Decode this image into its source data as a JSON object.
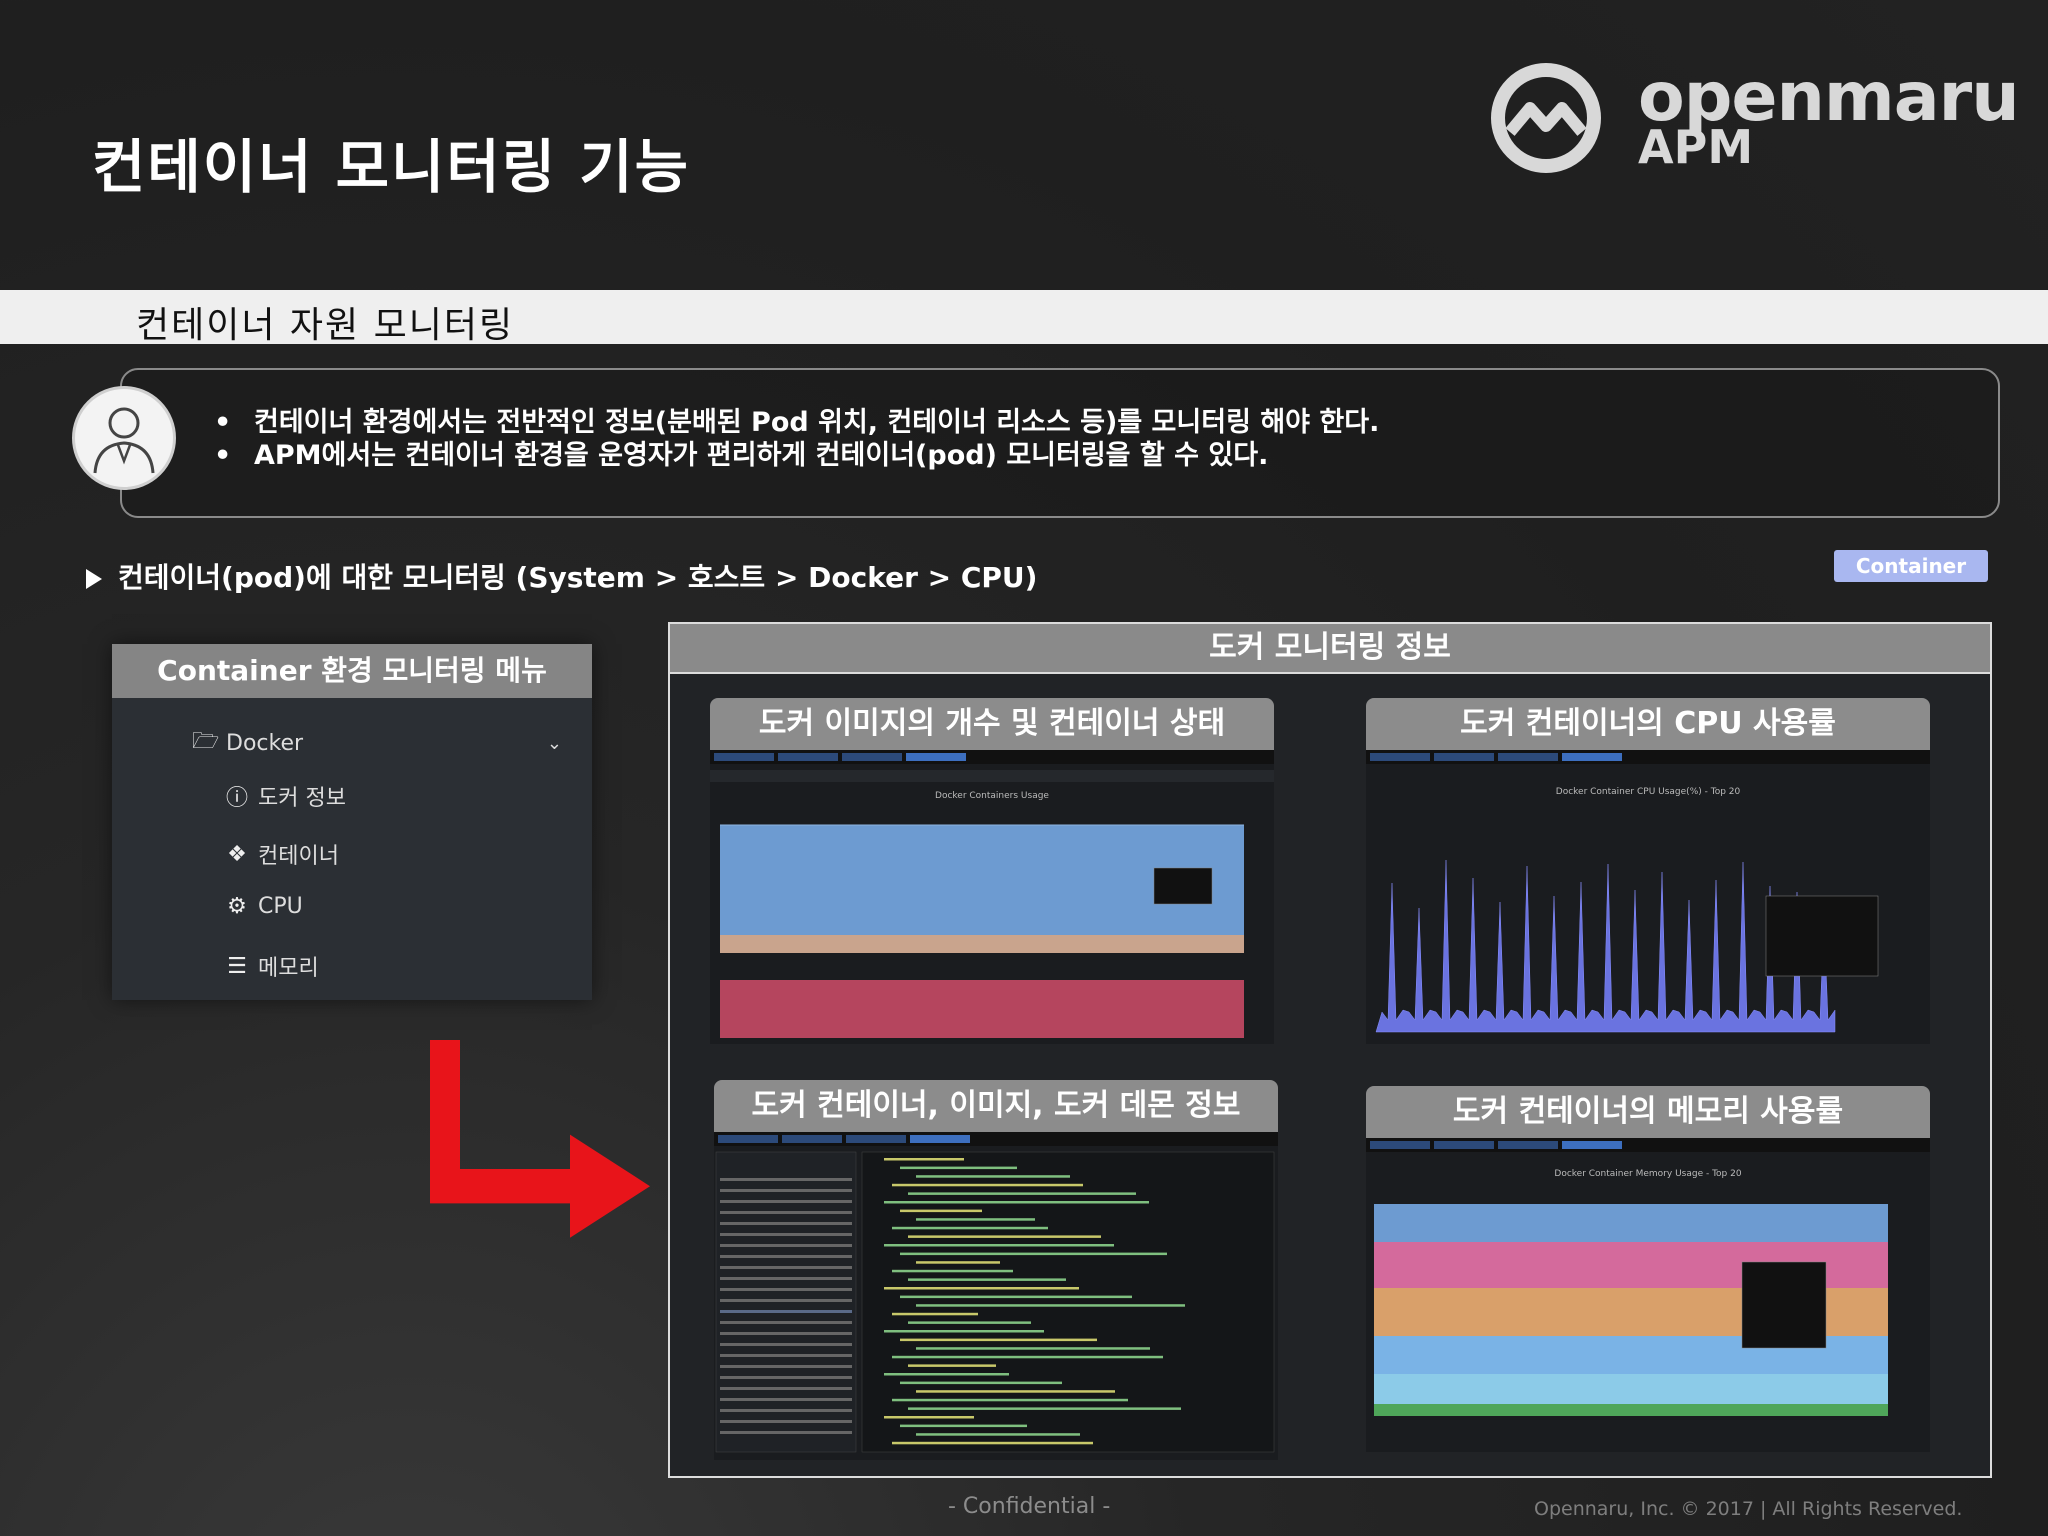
{
  "title": "컨테이너 모니터링 기능",
  "logo": {
    "brand": "openmaru",
    "product": "APM"
  },
  "section_label": "컨테이너 자원 모니터링",
  "bullets": [
    "컨테이너 환경에서는 전반적인 정보(분배된 Pod 위치, 컨테이너 리소스 등)를 모니터링 해야 한다.",
    "APM에서는 컨테이너 환경을 운영자가 편리하게 컨테이너(pod) 모니터링을 할 수 있다."
  ],
  "path_text": "컨테이너(pod)에 대한 모니터링 (System > 호스트 > Docker > CPU)",
  "tag": "Container",
  "menu": {
    "header": "Container 환경 모니터링 메뉴",
    "group": "Docker",
    "items": [
      {
        "label": "도커 정보",
        "icon": "info-icon"
      },
      {
        "label": "컨테이너",
        "icon": "cubes-icon"
      },
      {
        "label": "CPU",
        "icon": "gears-icon"
      },
      {
        "label": "메모리",
        "icon": "memory-icon"
      }
    ]
  },
  "panel_title": "도커 모니터링 정보",
  "cards": {
    "c1": {
      "title": "도커 이미지의 개수 및 컨테이너 상태",
      "chart_title": "Docker Containers Usage"
    },
    "c2": {
      "title": "도커 컨테이너의 CPU 사용률",
      "chart_title": "Docker Container CPU Usage(%) - Top 20"
    },
    "c3": {
      "title": "도커 컨테이너, 이미지, 도커 데몬 정보"
    },
    "c4": {
      "title": "도커 컨테이너의 메모리 사용률",
      "chart_title": "Docker Container Memory Usage - Top 20"
    }
  },
  "colors": {
    "arrow": "#e8141a",
    "tag": "#a9b7f0",
    "blue_area": "#6d9bd1",
    "pink_area": "#b5455e"
  },
  "footer": {
    "confidential": "- Confidential -",
    "copyright": "Opennaru, Inc. © 2017 | All Rights Reserved."
  }
}
